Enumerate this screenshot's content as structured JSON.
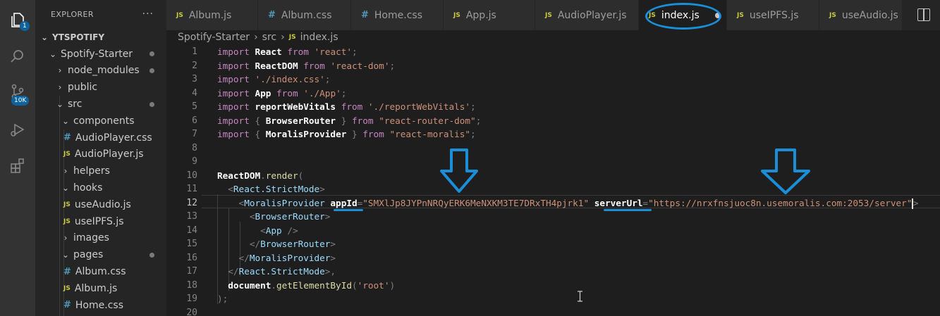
{
  "activity_bar": {
    "explorer_badge": "1",
    "source_control_badge": "10K"
  },
  "sidebar": {
    "title": "EXPLORER",
    "more": "···",
    "tree": [
      {
        "label": "YTSPOTIFY",
        "level": 0,
        "kind": "folder-open",
        "root": true
      },
      {
        "label": "Spotify-Starter",
        "level": 1,
        "kind": "folder-open",
        "dot": true
      },
      {
        "label": "node_modules",
        "level": 2,
        "kind": "folder-closed",
        "dot": true
      },
      {
        "label": "public",
        "level": 2,
        "kind": "folder-closed"
      },
      {
        "label": "src",
        "level": 2,
        "kind": "folder-open",
        "dot": true
      },
      {
        "label": "components",
        "level": 3,
        "kind": "folder-open"
      },
      {
        "label": "AudioPlayer.css",
        "level": 4,
        "kind": "css"
      },
      {
        "label": "AudioPlayer.js",
        "level": 4,
        "kind": "js"
      },
      {
        "label": "helpers",
        "level": 3,
        "kind": "folder-closed"
      },
      {
        "label": "hooks",
        "level": 3,
        "kind": "folder-open"
      },
      {
        "label": "useAudio.js",
        "level": 4,
        "kind": "js"
      },
      {
        "label": "useIPFS.js",
        "level": 4,
        "kind": "js"
      },
      {
        "label": "images",
        "level": 3,
        "kind": "folder-closed"
      },
      {
        "label": "pages",
        "level": 3,
        "kind": "folder-open",
        "dot": true
      },
      {
        "label": "Album.css",
        "level": 4,
        "kind": "css"
      },
      {
        "label": "Album.js",
        "level": 4,
        "kind": "js"
      },
      {
        "label": "Home.css",
        "level": 4,
        "kind": "css"
      }
    ]
  },
  "tabs": [
    {
      "label": "Album.js",
      "kind": "js",
      "width": 130
    },
    {
      "label": "Album.css",
      "kind": "css",
      "width": 132
    },
    {
      "label": "Home.css",
      "kind": "css",
      "width": 131
    },
    {
      "label": "App.js",
      "kind": "js",
      "width": 130
    },
    {
      "label": "AudioPlayer.js",
      "kind": "js",
      "width": 147
    },
    {
      "label": "index.js",
      "kind": "js",
      "width": 125,
      "active": true,
      "modified": true
    },
    {
      "label": "useIPFS.js",
      "kind": "js",
      "width": 131
    },
    {
      "label": "useAudio.js",
      "kind": "js",
      "width": 118
    }
  ],
  "breadcrumb": {
    "parts": [
      "Spotify-Starter",
      "src"
    ],
    "file": "index.js",
    "file_icon": "JS"
  },
  "editor": {
    "current_line": 12,
    "lines": [
      {
        "n": "1",
        "tokens": [
          [
            "kw",
            "import "
          ],
          [
            "id",
            "React"
          ],
          [
            "kw",
            " from "
          ],
          [
            "st",
            "'react'"
          ],
          [
            "pn",
            ";"
          ]
        ]
      },
      {
        "n": "2",
        "tokens": [
          [
            "kw",
            "import "
          ],
          [
            "id",
            "ReactDOM"
          ],
          [
            "kw",
            " from "
          ],
          [
            "st",
            "'react-dom'"
          ],
          [
            "pn",
            ";"
          ]
        ]
      },
      {
        "n": "3",
        "tokens": [
          [
            "kw",
            "import "
          ],
          [
            "st",
            "'./index.css'"
          ],
          [
            "pn",
            ";"
          ]
        ]
      },
      {
        "n": "4",
        "tokens": [
          [
            "kw",
            "import "
          ],
          [
            "id",
            "App"
          ],
          [
            "kw",
            " from "
          ],
          [
            "st",
            "'./App'"
          ],
          [
            "pn",
            ";"
          ]
        ]
      },
      {
        "n": "5",
        "tokens": [
          [
            "kw",
            "import "
          ],
          [
            "id",
            "reportWebVitals"
          ],
          [
            "kw",
            " from "
          ],
          [
            "st",
            "'./reportWebVitals'"
          ],
          [
            "pn",
            ";"
          ]
        ]
      },
      {
        "n": "6",
        "tokens": [
          [
            "kw",
            "import "
          ],
          [
            "pn",
            "{ "
          ],
          [
            "id",
            "BrowserRouter"
          ],
          [
            "pn",
            " } "
          ],
          [
            "kw",
            "from "
          ],
          [
            "st",
            "\"react-router-dom\""
          ],
          [
            "pn",
            ";"
          ]
        ]
      },
      {
        "n": "7",
        "tokens": [
          [
            "kw",
            "import "
          ],
          [
            "pn",
            "{ "
          ],
          [
            "id",
            "MoralisProvider"
          ],
          [
            "pn",
            " } "
          ],
          [
            "kw",
            "from "
          ],
          [
            "st",
            "\"react-moralis\""
          ],
          [
            "pn",
            ";"
          ]
        ]
      },
      {
        "n": "8",
        "tokens": []
      },
      {
        "n": "9",
        "tokens": []
      },
      {
        "n": "10",
        "tokens": [
          [
            "id",
            "ReactDOM"
          ],
          [
            "pn",
            "."
          ],
          [
            "fn",
            "render"
          ],
          [
            "pn",
            "("
          ]
        ]
      },
      {
        "n": "11",
        "tokens": [
          [
            "pn",
            "  <"
          ],
          [
            "tg",
            "React.StrictMode"
          ],
          [
            "pn",
            ">"
          ]
        ]
      },
      {
        "n": "12",
        "tokens": [
          [
            "pn",
            "    <"
          ],
          [
            "tg",
            "MoralisProvider "
          ],
          [
            "at",
            "appId"
          ],
          [
            "pn",
            "="
          ],
          [
            "st",
            "\"SMXlJp8JYPnNRQyERK6MeNXKM3TE7DRxTH4pjrk1\""
          ],
          [
            "pn",
            " "
          ],
          [
            "at",
            "serverUrl"
          ],
          [
            "pn",
            "="
          ],
          [
            "st",
            "\"https://nrxfnsjuoc8n.usemoralis.com:2053/server\""
          ],
          [
            "caret",
            ""
          ],
          [
            "pn",
            ">"
          ]
        ]
      },
      {
        "n": "13",
        "tokens": [
          [
            "pn",
            "      <"
          ],
          [
            "tg",
            "BrowserRouter"
          ],
          [
            "pn",
            ">"
          ]
        ]
      },
      {
        "n": "14",
        "tokens": [
          [
            "pn",
            "        <"
          ],
          [
            "tg",
            "App "
          ],
          [
            "pn",
            "/>"
          ]
        ]
      },
      {
        "n": "15",
        "tokens": [
          [
            "pn",
            "      </"
          ],
          [
            "tg",
            "BrowserRouter"
          ],
          [
            "pn",
            ">"
          ]
        ]
      },
      {
        "n": "16",
        "tokens": [
          [
            "pn",
            "    </"
          ],
          [
            "tg",
            "MoralisProvider"
          ],
          [
            "pn",
            ">"
          ]
        ]
      },
      {
        "n": "17",
        "tokens": [
          [
            "pn",
            "  </"
          ],
          [
            "tg",
            "React.StrictMode"
          ],
          [
            "pn",
            ">,"
          ]
        ]
      },
      {
        "n": "18",
        "tokens": [
          [
            "pn",
            "  "
          ],
          [
            "id",
            "document"
          ],
          [
            "pn",
            "."
          ],
          [
            "fn",
            "getElementById"
          ],
          [
            "pn",
            "("
          ],
          [
            "st",
            "'root'"
          ],
          [
            "pn",
            ")"
          ]
        ]
      },
      {
        "n": "19",
        "tokens": [
          [
            "pn",
            ");"
          ]
        ]
      },
      {
        "n": "20",
        "tokens": []
      }
    ]
  },
  "colors": {
    "annotation": "#1a8fd8",
    "keyword": "#c586c0",
    "string": "#ce9178",
    "tag": "#9cdcfe"
  }
}
